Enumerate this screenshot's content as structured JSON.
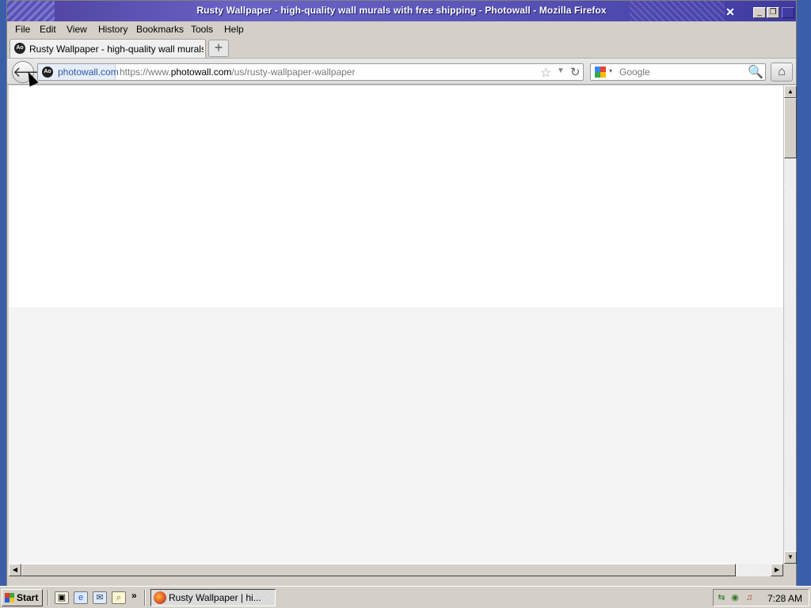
{
  "window": {
    "title": "Rusty Wallpaper - high-quality wall murals with free shipping - Photowall - Mozilla Firefox",
    "minimize_glyph": "_",
    "restore_glyph": "❐",
    "close_glyph": "✕"
  },
  "menubar": {
    "items": [
      {
        "label": "File"
      },
      {
        "label": "Edit"
      },
      {
        "label": "View"
      },
      {
        "label": "History"
      },
      {
        "label": "Bookmarks"
      },
      {
        "label": "Tools"
      },
      {
        "label": "Help"
      }
    ]
  },
  "tabs": [
    {
      "label": "Rusty Wallpaper - high-quality wall murals wit...",
      "favicon_text": "Ao",
      "active": true
    }
  ],
  "newtab_glyph": "+",
  "navbar": {
    "back_glyph": "🡐",
    "identity_label": "photowall.com",
    "identity_icon_text": "Ao",
    "url_prefix": "https://www.",
    "url_domain": "photowall.com",
    "url_path": "/us/rusty-wallpaper-wallpaper",
    "star_glyph": "☆",
    "dropmarker_glyph": "▼",
    "reload_glyph": "↻",
    "search_placeholder": "Google",
    "search_caret_glyph": "▾",
    "magnifier_glyph": "🔍",
    "home_glyph": "⌂"
  },
  "scrollbars": {
    "up_glyph": "▲",
    "down_glyph": "▼",
    "left_glyph": "◀",
    "right_glyph": "▶"
  },
  "taskbar": {
    "start_label": "Start",
    "quicklaunch_chevron": "»",
    "task_button_label": "Rusty Wallpaper | hi...",
    "clock": "7:28 AM"
  },
  "colors": {
    "titlebar_accent": "#5a55b8",
    "desktop": "#3b5ea8",
    "identity_text": "#2a5aa8"
  }
}
